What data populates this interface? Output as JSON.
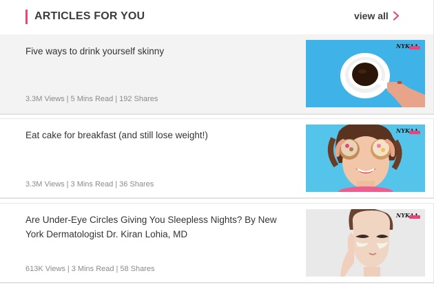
{
  "header": {
    "title": "ARTICLES FOR YOU",
    "view_all": "view all",
    "accent_color": "#e8457d"
  },
  "articles": [
    {
      "title": "Five ways to drink yourself skinny",
      "views": "3.3M Views",
      "read_time": "5 Mins Read",
      "shares": "192 Shares",
      "thumbnail": "coffee-cup-image",
      "brand_mark": "NYKAA"
    },
    {
      "title": "Eat cake for breakfast (and still lose weight!)",
      "views": "3.3M Views",
      "read_time": "3 Mins Read",
      "shares": "36 Shares",
      "thumbnail": "woman-cupcakes-image",
      "brand_mark": "NYKAA"
    },
    {
      "title": "Are Under-Eye Circles Giving You Sleepless Nights? By New York Dermatologist Dr. Kiran Lohia, MD",
      "views": "613K Views",
      "read_time": "3 Mins Read",
      "shares": "58 Shares",
      "thumbnail": "under-eye-patch-image",
      "brand_mark": "NYKAA"
    }
  ]
}
